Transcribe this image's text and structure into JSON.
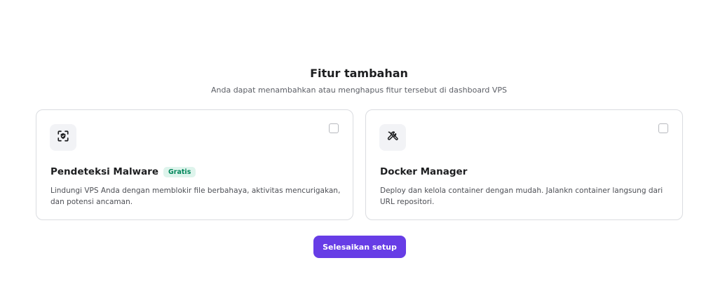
{
  "header": {
    "title": "Fitur tambahan",
    "subtitle": "Anda dapat menambahkan atau menghapus fitur tersebut di dashboard VPS"
  },
  "features": [
    {
      "icon": "shield-scan-icon",
      "title": "Pendeteksi Malware",
      "badge": "Gratis",
      "description": "Lindungi VPS Anda dengan memblokir file berbahaya, aktivitas mencurigakan, dan potensi ancaman.",
      "checked": false
    },
    {
      "icon": "tools-icon",
      "title": "Docker Manager",
      "badge": "",
      "description": "Deploy dan kelola container dengan mudah. Jalankn container langsung dari URL repositori.",
      "checked": false
    }
  ],
  "actions": {
    "finish_label": "Selesaikan setup"
  },
  "colors": {
    "primary": "#673de6",
    "badge_text": "#00865a",
    "badge_bg": "#def4ec",
    "border": "#dadce0"
  }
}
